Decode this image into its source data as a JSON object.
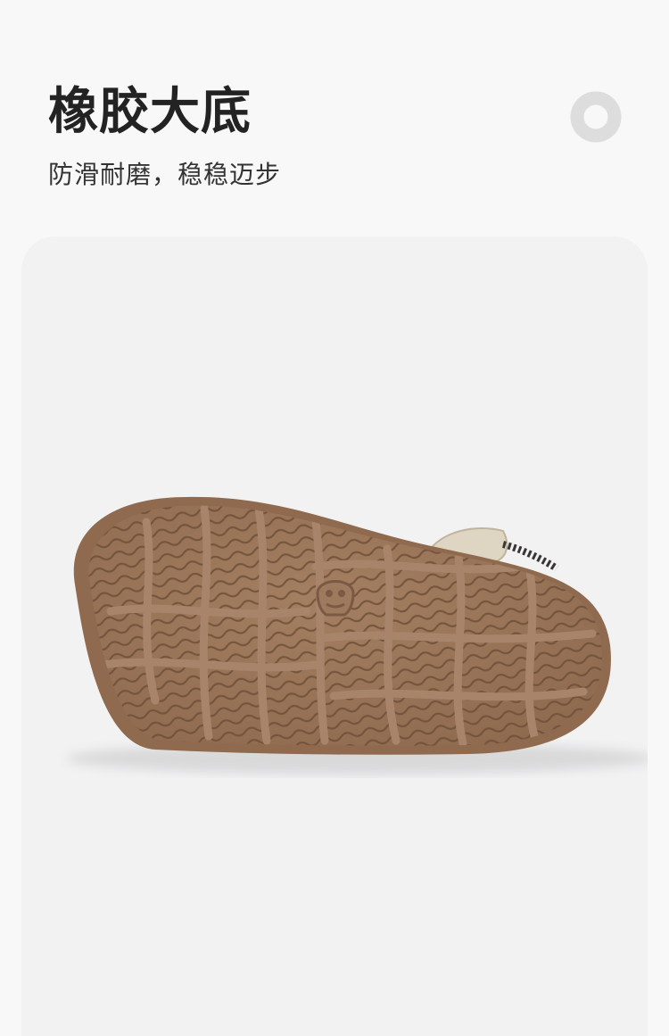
{
  "header": {
    "title": "橡胶大底",
    "subtitle": "防滑耐磨，稳稳迈步"
  },
  "decor": {
    "icon": "ring-icon",
    "ring_color": "#dddddd"
  },
  "product": {
    "icon": "shoe-sole-image",
    "sole_color": "#9a7659",
    "background_color": "#f2f2f3"
  }
}
